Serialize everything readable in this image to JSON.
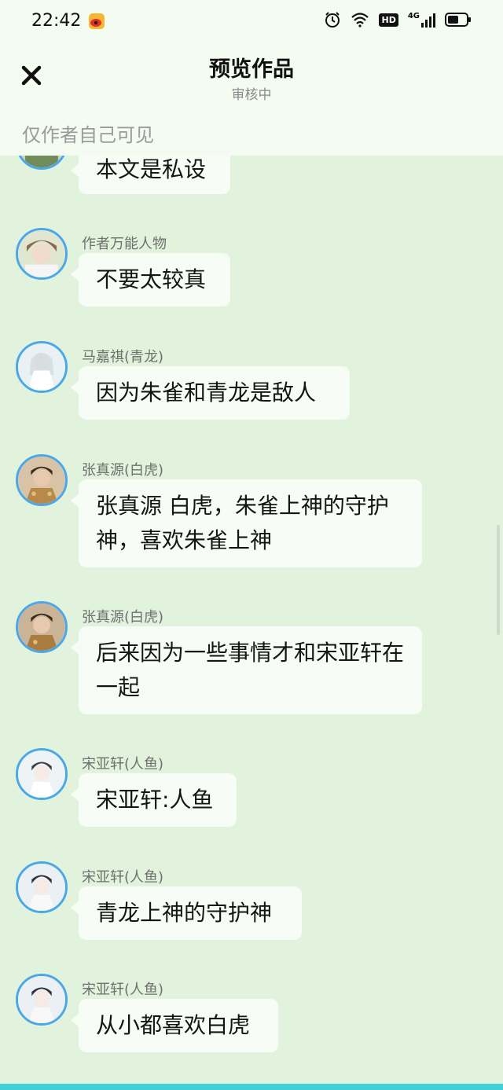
{
  "status": {
    "time": "22:42",
    "hd_badge": "HD",
    "net_label": "4G"
  },
  "header": {
    "title": "预览作品",
    "subtitle": "审核中",
    "visibility_note": "仅作者自己可见"
  },
  "messages": [
    {
      "name": "",
      "text": "本文是私设"
    },
    {
      "name": "作者万能人物",
      "text": "不要太较真"
    },
    {
      "name": "马嘉祺(青龙)",
      "text": "因为朱雀和青龙是敌人"
    },
    {
      "name": "张真源(白虎)",
      "text": "张真源 白虎，朱雀上神的守护神，喜欢朱雀上神"
    },
    {
      "name": "张真源(白虎)",
      "text": "后来因为一些事情才和宋亚轩在一起"
    },
    {
      "name": "宋亚轩(人鱼)",
      "text": "宋亚轩:人鱼"
    },
    {
      "name": "宋亚轩(人鱼)",
      "text": "青龙上神的守护神"
    },
    {
      "name": "宋亚轩(人鱼)",
      "text": "从小都喜欢白虎"
    }
  ],
  "colors": {
    "background": "#e2f3dd",
    "avatar_border": "#4ba7e8",
    "bubble": "#f7fdf6"
  }
}
